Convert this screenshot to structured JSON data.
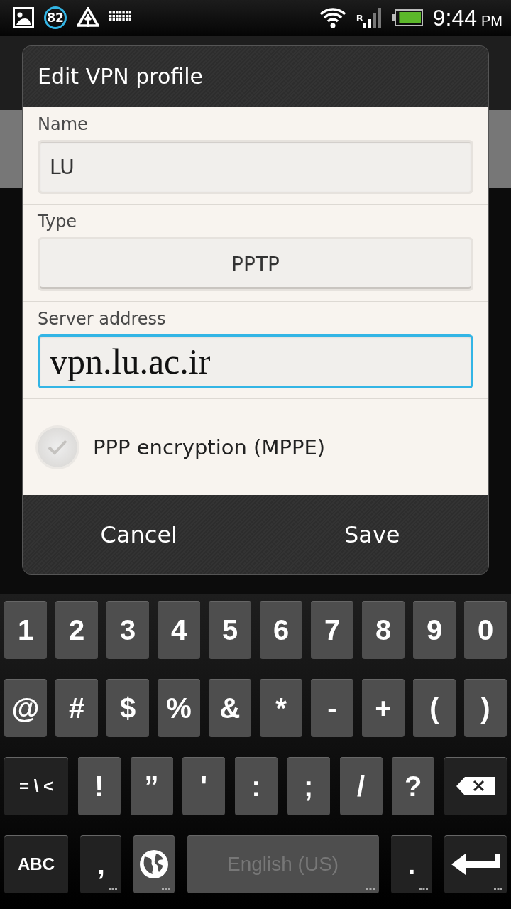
{
  "status_bar": {
    "notification_count": "82",
    "roaming": "R",
    "time": "9:44",
    "meridiem": "PM"
  },
  "dialog": {
    "title": "Edit VPN profile",
    "fields": [
      {
        "kind": "text",
        "label": "Name",
        "value": "LU",
        "focused": false
      },
      {
        "kind": "select",
        "label": "Type",
        "value": "PPTP",
        "focused": false
      },
      {
        "kind": "text",
        "label": "Server address",
        "value": "vpn.lu.ac.ir",
        "focused": true
      }
    ],
    "checkbox": {
      "label": "PPP encryption (MPPE)",
      "checked": false
    },
    "buttons": [
      "Cancel",
      "Save"
    ]
  },
  "keyboard": {
    "rows": [
      {
        "keys": [
          {
            "kind": "char",
            "label": "1",
            "more": false
          },
          {
            "kind": "char",
            "label": "2",
            "more": false
          },
          {
            "kind": "char",
            "label": "3",
            "more": false
          },
          {
            "kind": "char",
            "label": "4",
            "more": false
          },
          {
            "kind": "char",
            "label": "5",
            "more": false
          },
          {
            "kind": "char",
            "label": "6",
            "more": false
          },
          {
            "kind": "char",
            "label": "7",
            "more": false
          },
          {
            "kind": "char",
            "label": "8",
            "more": false
          },
          {
            "kind": "char",
            "label": "9",
            "more": false
          },
          {
            "kind": "char",
            "label": "0",
            "more": false
          }
        ]
      },
      {
        "keys": [
          {
            "kind": "char",
            "label": "@",
            "more": false
          },
          {
            "kind": "char",
            "label": "#",
            "more": false
          },
          {
            "kind": "char",
            "label": "$",
            "more": false
          },
          {
            "kind": "char",
            "label": "%",
            "more": false
          },
          {
            "kind": "char",
            "label": "&",
            "more": false
          },
          {
            "kind": "char",
            "label": "*",
            "more": false
          },
          {
            "kind": "char",
            "label": "-",
            "more": false
          },
          {
            "kind": "char",
            "label": "+",
            "more": false
          },
          {
            "kind": "char",
            "label": "(",
            "more": false
          },
          {
            "kind": "char",
            "label": ")",
            "more": false
          }
        ]
      },
      {
        "keys": [
          {
            "kind": "mode",
            "label": "= \\ <",
            "more": false
          },
          {
            "kind": "char",
            "label": "!",
            "more": false
          },
          {
            "kind": "char",
            "label": "”",
            "more": false
          },
          {
            "kind": "char",
            "label": "'",
            "more": false
          },
          {
            "kind": "char",
            "label": ":",
            "more": false
          },
          {
            "kind": "char",
            "label": ";",
            "more": false
          },
          {
            "kind": "char",
            "label": "/",
            "more": false
          },
          {
            "kind": "char",
            "label": "?",
            "more": false
          },
          {
            "kind": "backspace",
            "more": false
          }
        ]
      },
      {
        "keys": [
          {
            "kind": "mode",
            "label": "ABC",
            "more": false
          },
          {
            "kind": "punct",
            "label": ",",
            "more": true
          },
          {
            "kind": "globe",
            "more": true
          },
          {
            "kind": "space",
            "label": "English (US)",
            "more": true
          },
          {
            "kind": "punct",
            "label": ".",
            "more": true
          },
          {
            "kind": "enter",
            "more": true
          }
        ]
      }
    ]
  }
}
